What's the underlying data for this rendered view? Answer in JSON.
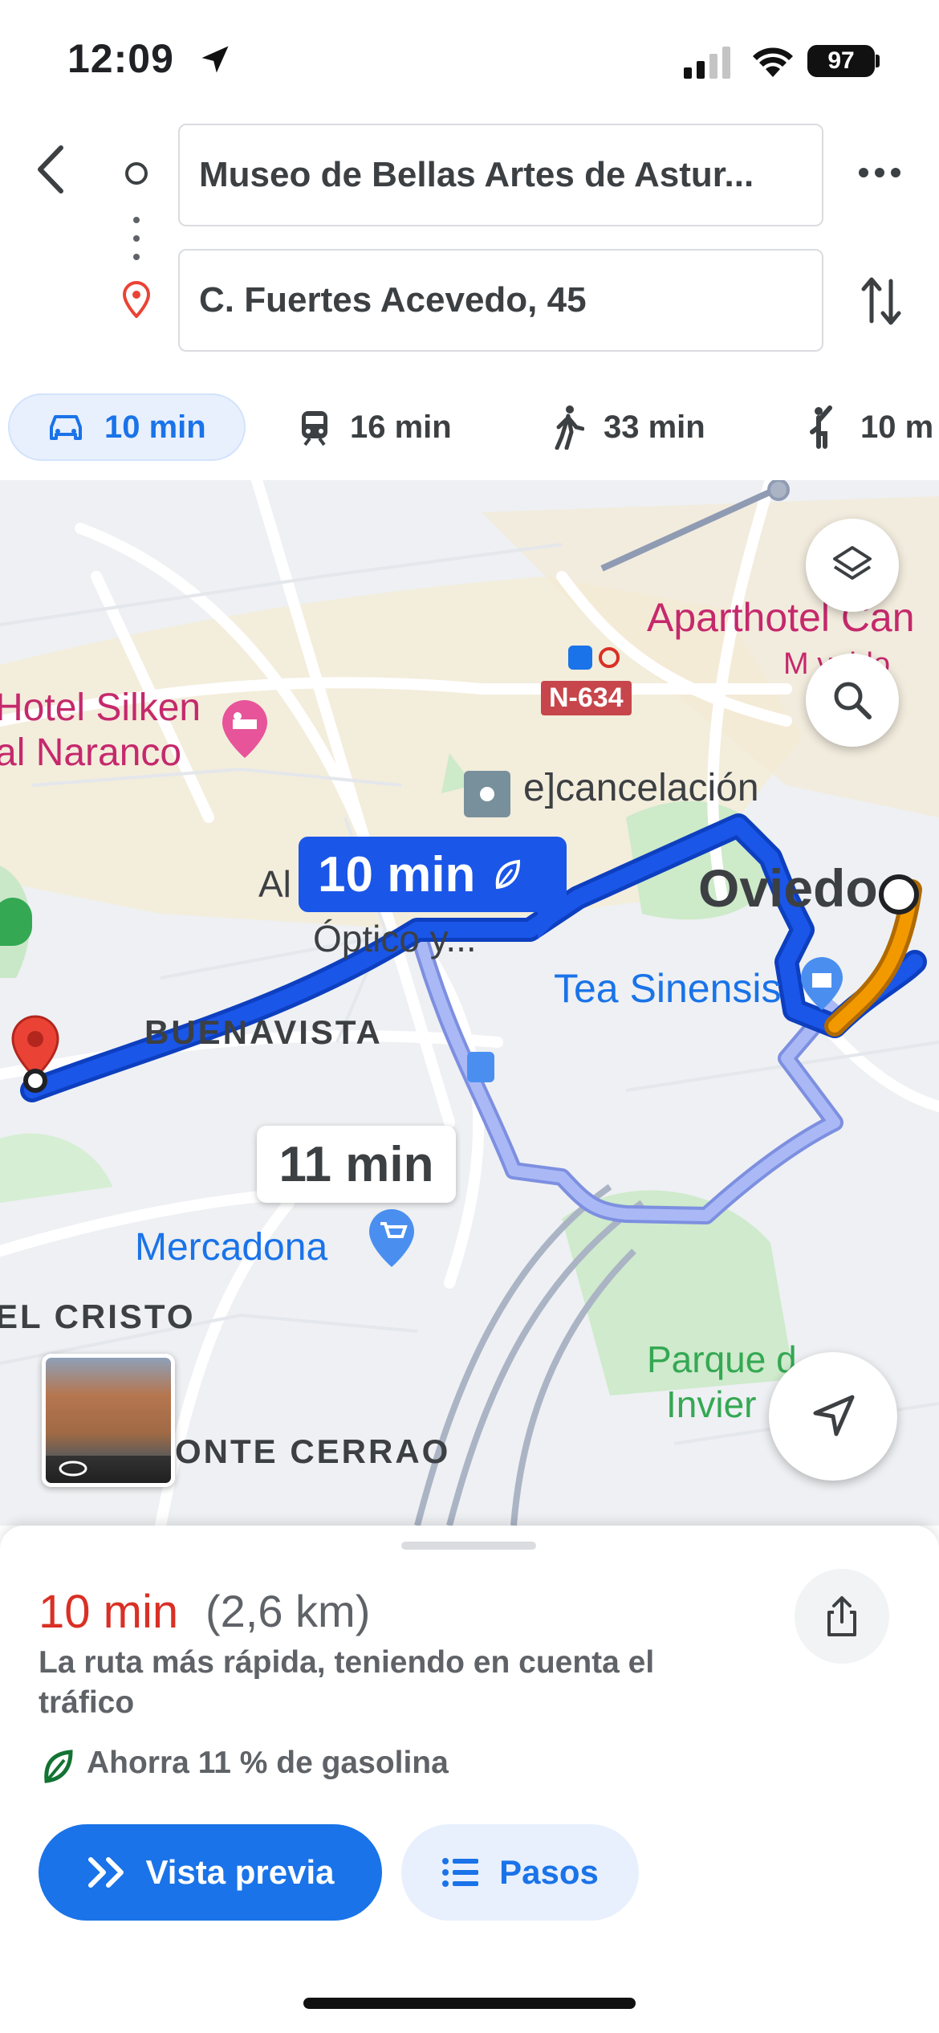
{
  "status_bar": {
    "time": "12:09",
    "battery": "97"
  },
  "directions": {
    "origin": "Museo de Bellas Artes de Astur...",
    "destination": "C. Fuertes Acevedo, 45"
  },
  "modes": [
    {
      "name": "car",
      "label": "10 min",
      "active": true
    },
    {
      "name": "transit",
      "label": "16 min"
    },
    {
      "name": "walk",
      "label": "33 min"
    },
    {
      "name": "ride",
      "label": "10 m"
    }
  ],
  "map": {
    "labels": {
      "aparthotel": "Aparthotel Can",
      "mvaldo": "M   valdo",
      "n634": "N-634",
      "hotel1": "Hotel Silken",
      "hotel2": "al Naranco",
      "cancelacion": "e]cancelación",
      "oviedo": "Oviedo",
      "al": "Al",
      "optico": "Óptico y...",
      "tea": "Tea Sinensis",
      "buenavista": "BUENAVISTA",
      "mercadona": "Mercadona",
      "elcristo": "EL CRISTO",
      "montecerrao": "ONTE CERRAO",
      "parque1": "Parque d",
      "parque2": "Invier"
    },
    "route_main_label": "10 min",
    "route_alt_label": "11 min",
    "colors": {
      "route": "#1a56e8",
      "route_alt": "#a7b8f5",
      "traffic": "#f29900",
      "pin": "#ea4335"
    }
  },
  "summary": {
    "eta": "10 min",
    "distance": "(2,6 km)",
    "description": "La ruta más rápida, teniendo en cuenta el tráfico",
    "savings": "Ahorra 11 % de gasolina",
    "preview_label": "Vista previa",
    "steps_label": "Pasos"
  }
}
